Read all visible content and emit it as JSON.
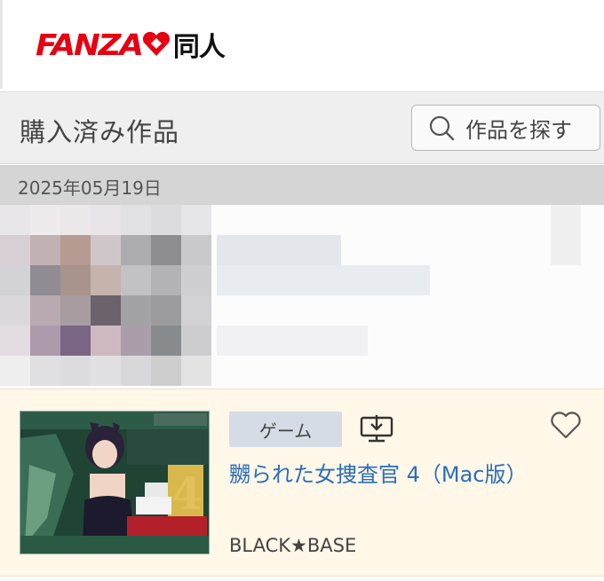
{
  "header": {
    "logo_brand": "FANZA",
    "logo_section": "同人",
    "logo_icon": "fanza-heart-logo-icon"
  },
  "section": {
    "title": "購入済み作品",
    "search_button": "作品を探す",
    "search_icon": "search-icon"
  },
  "date_group": {
    "date": "2025年05月19日"
  },
  "items": [
    {
      "blurred": true
    },
    {
      "category": "ゲーム",
      "title": "嬲られた女捜査官 4（Mac版）",
      "circle": "BLACK★BASE",
      "download_icon": "download-to-pc-icon",
      "favorite_icon": "heart-outline-icon"
    }
  ],
  "colors": {
    "brand_red": "#e60012",
    "link_blue": "#2a6ebd",
    "card_background": "#fff7e8",
    "date_bar": "#d5d5d5"
  }
}
